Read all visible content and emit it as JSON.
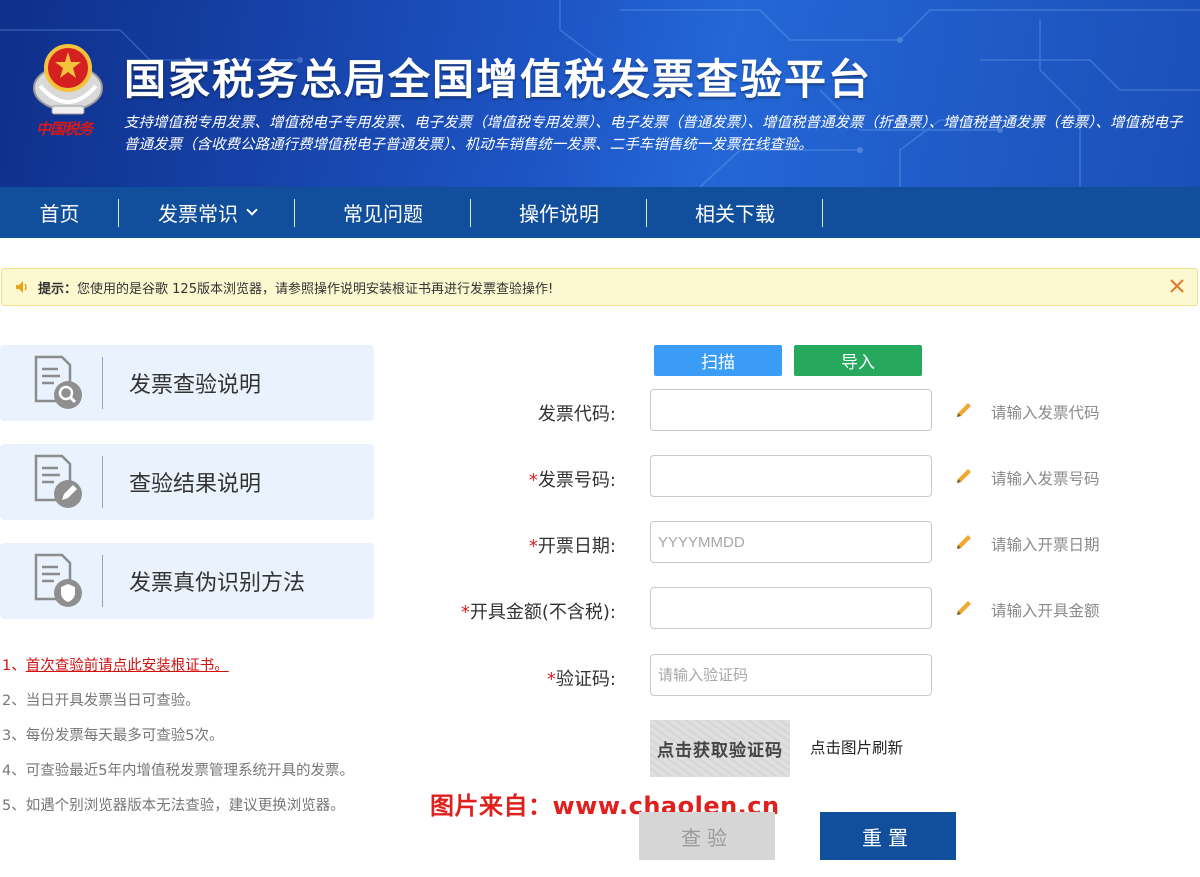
{
  "header": {
    "title": "国家税务总局全国增值税发票查验平台",
    "description": "支持增值税专用发票、增值税电子专用发票、电子发票（增值税专用发票）、电子发票（普通发票）、增值税普通发票（折叠票）、增值税普通发票（卷票）、增值税电子普通发票（含收费公路通行费增值税电子普通发票）、机动车销售统一发票、二手车销售统一发票在线查验。",
    "seal_text": "中国税务"
  },
  "nav": {
    "items": [
      {
        "label": "首页"
      },
      {
        "label": "发票常识"
      },
      {
        "label": "常见问题"
      },
      {
        "label": "操作说明"
      },
      {
        "label": "相关下载"
      }
    ]
  },
  "notice": {
    "prefix": "提示：",
    "text": "您使用的是谷歌 125版本浏览器，请参照操作说明安装根证书再进行发票查验操作!"
  },
  "sidebar": {
    "cards": [
      {
        "label": "发票查验说明",
        "icon": "document-search-icon"
      },
      {
        "label": "查验结果说明",
        "icon": "document-edit-icon"
      },
      {
        "label": "发票真伪识别方法",
        "icon": "document-shield-icon"
      }
    ],
    "tips": {
      "first_prefix": "1、",
      "first_link": "首次查验前请点此安装根证书。",
      "items": [
        "2、当日开具发票当日可查验。",
        "3、每份发票每天最多可查验5次。",
        "4、可查验最近5年内增值税发票管理系统开具的发票。",
        "5、如遇个别浏览器版本无法查验，建议更换浏览器。"
      ]
    }
  },
  "form": {
    "scan_label": "扫描",
    "import_label": "导入",
    "fields": {
      "code": {
        "label": "发票代码:",
        "required": false,
        "value": "",
        "placeholder": "",
        "hint": "请输入发票代码"
      },
      "number": {
        "label": "发票号码:",
        "required": true,
        "value": "",
        "placeholder": "",
        "hint": "请输入发票号码"
      },
      "date": {
        "label": "开票日期:",
        "required": true,
        "value": "",
        "placeholder": "YYYYMMDD",
        "hint": "请输入开票日期"
      },
      "amount": {
        "label": "开具金额(不含税):",
        "required": true,
        "value": "",
        "placeholder": "",
        "hint": "请输入开具金额"
      },
      "captcha": {
        "label": "验证码:",
        "required": true,
        "value": "",
        "placeholder": "请输入验证码"
      }
    },
    "required_mark": "*",
    "captcha_image_text": "点击获取验证码",
    "captcha_refresh": "点击图片刷新",
    "check_label": "查验",
    "reset_label": "重置"
  },
  "watermark": "图片来自：www.chaolen.cn",
  "colors": {
    "nav_bg": "#114f9c",
    "scan_btn": "#3a9cf5",
    "import_btn": "#26a95c",
    "reset_btn": "#114f9c",
    "check_btn_disabled": "#d6d6d6",
    "required": "#e21c1c"
  }
}
